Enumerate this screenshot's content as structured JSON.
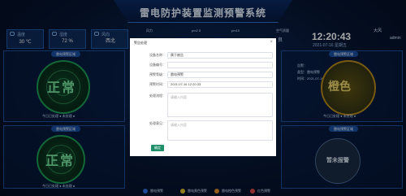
{
  "header": {
    "title": "雷电防护装置监测预警系统"
  },
  "weather": [
    {
      "label": "温度",
      "value": "30 ℃"
    },
    {
      "label": "湿度",
      "value": "72 %"
    },
    {
      "label": "风向",
      "value": "西北"
    }
  ],
  "top_tabs": [
    {
      "label": "风力"
    },
    {
      "label": "pm2.5"
    },
    {
      "label": "pm10"
    },
    {
      "label": "空气质量"
    }
  ],
  "air_quality_value": "良",
  "clock": {
    "time": "12:20:43",
    "date": "2021-07-16 星期五"
  },
  "right_info": {
    "weather_label": "大风",
    "user_label": "admin"
  },
  "panels": {
    "top_left": {
      "tag": "雷电预警区域",
      "radar_text": "正常",
      "stats": "今日已处理 ● 未处理 ●"
    },
    "bottom_left": {
      "tag": "雷电预警区域",
      "radar_text": "正常",
      "stats": "今日已处理 ● 未处理 ●"
    },
    "top_right": {
      "tag": "雷电预警区域",
      "radar_text": "橙色",
      "stats": "今日已处理 ● 未处理 ●",
      "info_lines": [
        "告警：",
        "类型：雷电预警",
        "时间：2021-07-16 12:20:43"
      ]
    },
    "bottom_right": {
      "tag": "雷电预警区域",
      "hourglass_text": "暂未报警"
    }
  },
  "legend": [
    {
      "label": "雷电预警",
      "color": "#2f6fe0"
    },
    {
      "label": "雷电黄色预警",
      "color": "#e0c12f"
    },
    {
      "label": "雷电橙色预警",
      "color": "#e08a2f"
    },
    {
      "label": "红色预警",
      "color": "#e04a4a"
    }
  ],
  "modal": {
    "title": "警告处理",
    "close": "×",
    "fields": [
      {
        "label": "设备名称：",
        "value": "属于被告"
      },
      {
        "label": "设备编号：",
        "value": ""
      },
      {
        "label": "预警等级：",
        "value": "雷电预警"
      },
      {
        "label": "预警时间：",
        "value": "2021-07-16 12:20:33"
      }
    ],
    "areas": [
      {
        "label": "处理流程：",
        "placeholder": "请输入内容"
      },
      {
        "label": "处理意见：",
        "placeholder": "请输入内容"
      }
    ],
    "submit": "确定"
  }
}
